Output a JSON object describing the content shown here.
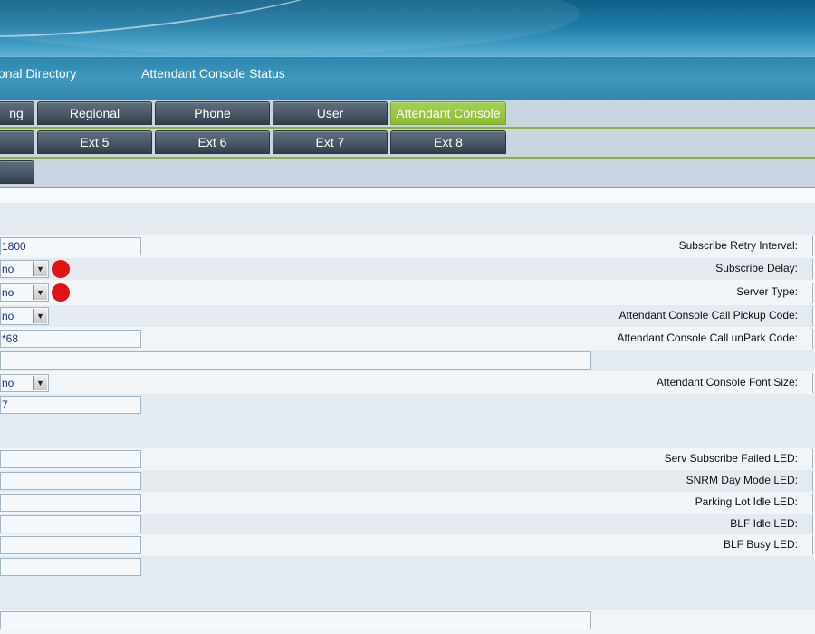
{
  "menu": {
    "items": [
      "onal Directory",
      "Attendant Console Status"
    ]
  },
  "tabs_row1": [
    "ng",
    "Regional",
    "Phone",
    "User",
    "Attendant Console"
  ],
  "tabs_row2": [
    "",
    "Ext 5",
    "Ext 6",
    "Ext 7",
    "Ext 8"
  ],
  "tabs_row3": [
    ""
  ],
  "form": {
    "subscribe_expires_value": "1800",
    "select1_value": "no",
    "select2_value": "no",
    "select3_value": "no",
    "code_value": "*68",
    "select4_value": "no",
    "value7": "7",
    "labels": {
      "subscribe_retry": "Subscribe Retry Interval:",
      "subscribe_delay": "Subscribe Delay:",
      "server_type": "Server Type:",
      "call_pickup": "Attendant Console Call Pickup Code:",
      "call_unpark": "Attendant Console Call unPark Code:",
      "font_size": "Attendant Console Font Size:",
      "serv_failed_led": "Serv Subscribe Failed LED:",
      "snrm_led": "SNRM Day Mode LED:",
      "parking_led": "Parking Lot Idle LED:",
      "blf_idle_led": "BLF Idle LED:",
      "blf_busy_led": "BLF Busy LED:"
    }
  },
  "colors": {
    "active_tab": "#8cbc35",
    "required_dot": "#e01212",
    "input_text": "#1f2f86"
  }
}
